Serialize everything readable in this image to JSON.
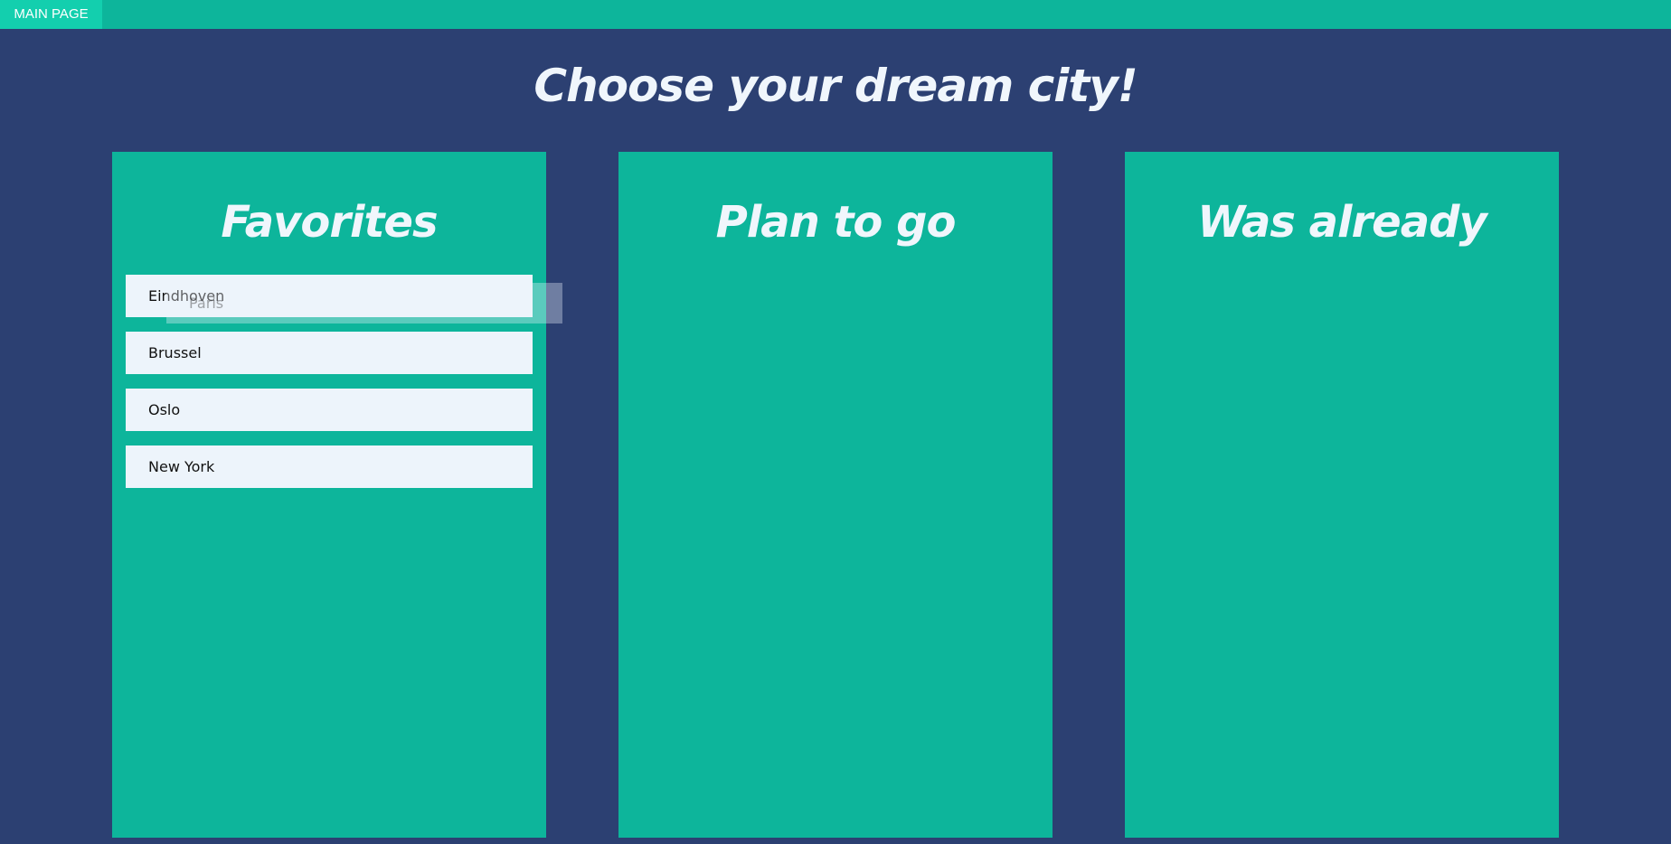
{
  "nav": {
    "main_page_label": "MAIN PAGE"
  },
  "header": {
    "title": "Choose your dream city!"
  },
  "columns": [
    {
      "title": "Favorites",
      "cards": [
        "Eindhoven",
        "Brussel",
        "Oslo",
        "New York"
      ]
    },
    {
      "title": "Plan to go",
      "cards": []
    },
    {
      "title": "Was already",
      "cards": []
    }
  ],
  "drag": {
    "ghost_label": "Paris"
  },
  "colors": {
    "background": "#2c4072",
    "accent": "#0db59b",
    "button": "#13cfae",
    "card": "#edf4fb",
    "title_text": "#f0f6fc"
  }
}
